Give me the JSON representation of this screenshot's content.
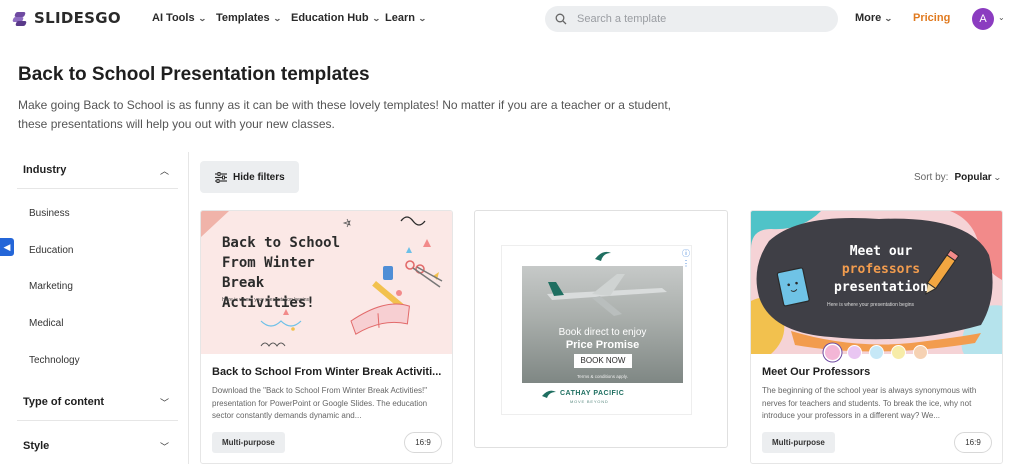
{
  "header": {
    "logo": "SLIDESGO",
    "nav": [
      "AI Tools",
      "Templates",
      "Education Hub",
      "Learn"
    ],
    "search_placeholder": "Search a template",
    "more": "More",
    "pricing": "Pricing",
    "avatar_initial": "A"
  },
  "page": {
    "title": "Back to School Presentation templates",
    "description": "Make going Back to School is as funny as it can be with these lovely templates! No matter if you are a teacher or a student, these presentations will help you out with your new classes."
  },
  "sidebar": {
    "industry": {
      "label": "Industry",
      "options": [
        "Business",
        "Education",
        "Marketing",
        "Medical",
        "Technology"
      ]
    },
    "type_of_content": "Type of content",
    "style": "Style"
  },
  "toolbar": {
    "hide_filters": "Hide filters",
    "sort_label": "Sort by:",
    "sort_value": "Popular"
  },
  "cards": [
    {
      "image_title": "Back to School From Winter Break Activities!",
      "image_sub": "Here is where your presentation begins",
      "title": "Back to School From Winter Break Activiti...",
      "desc": "Download the \"Back to School From Winter Break Activities!\" presentation for PowerPoint or Google Slides. The education sector constantly demands dynamic and...",
      "tag": "Multi-purpose",
      "ratio": "16:9"
    },
    {
      "image_title": "Meet our professors presentation",
      "image_title_1": "Meet our",
      "image_title_2": "professors",
      "image_title_3": "presentation",
      "image_sub": "Here is where your presentation begins",
      "title": "Meet Our Professors",
      "desc": "The beginning of the school year is always synonymous with nerves for teachers and students. To break the ice, why not introduce your professors in a different way? We...",
      "tag": "Multi-purpose",
      "ratio": "16:9",
      "swatches": [
        "#f3b6d6",
        "#e9c6f2",
        "#c6e8f7",
        "#f7eca8",
        "#f6d2b3"
      ]
    }
  ],
  "ad": {
    "line1": "Book direct to enjoy",
    "line2": "Price Promise",
    "button": "BOOK NOW",
    "terms": "Terms & conditions apply.",
    "brand": "CATHAY PACIFIC",
    "tagline": "MOVE BEYOND"
  },
  "colors": {
    "accent_pricing": "#e07a1f",
    "avatar": "#8b3cc0",
    "logo": "#6e4aa1",
    "feedback_tab": "#2466d8"
  }
}
